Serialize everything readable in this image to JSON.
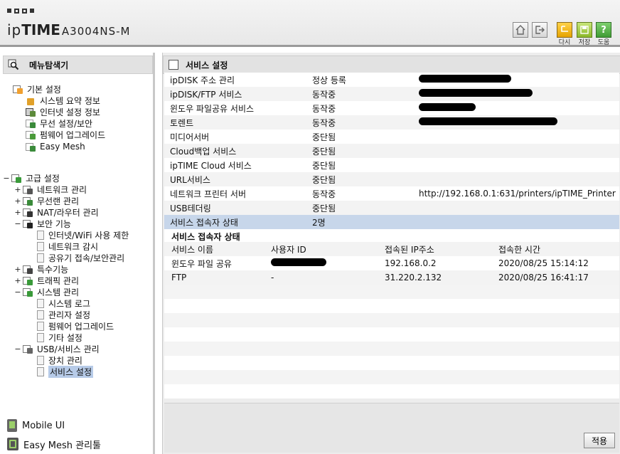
{
  "header": {
    "brand_light": "ip",
    "brand_bold": "TIME",
    "model": "A3004NS-M",
    "buttons": [
      {
        "icon": "home-icon",
        "label": ""
      },
      {
        "icon": "logout-icon",
        "label": ""
      },
      {
        "icon": "reload-icon",
        "label": "다시"
      },
      {
        "icon": "save-icon",
        "label": "저장"
      },
      {
        "icon": "help-icon",
        "label": "도움"
      }
    ]
  },
  "sidebar": {
    "title": "메뉴탐색기",
    "basic": {
      "label": "기본 설정",
      "items": [
        "시스템 요약 정보",
        "인터넷 설정 정보",
        "무선 설정/보안",
        "펌웨어 업그레이드",
        "Easy Mesh"
      ]
    },
    "advanced": {
      "label": "고급 설정",
      "groups": [
        {
          "toggle": "+",
          "label": "네트워크 관리"
        },
        {
          "toggle": "+",
          "label": "무선랜 관리"
        },
        {
          "toggle": "+",
          "label": "NAT/라우터 관리"
        },
        {
          "toggle": "−",
          "label": "보안 기능",
          "children": [
            "인터넷/WiFi 사용 제한",
            "네트워크 감시",
            "공유기 접속/보안관리"
          ]
        },
        {
          "toggle": "+",
          "label": "특수기능"
        },
        {
          "toggle": "+",
          "label": "트래픽 관리"
        },
        {
          "toggle": "−",
          "label": "시스템 관리",
          "children": [
            "시스템 로그",
            "관리자 설정",
            "펌웨어 업그레이드",
            "기타 설정"
          ]
        },
        {
          "toggle": "−",
          "label": "USB/서비스 관리",
          "children": [
            "장치 관리",
            "서비스 설정"
          ]
        }
      ]
    },
    "advanced_toggle": "−",
    "bottom_links": [
      "Mobile UI",
      "Easy Mesh 관리툴"
    ]
  },
  "main": {
    "title": "서비스 설정",
    "services": [
      {
        "name": "ipDISK 주소 관리",
        "status": "정상 등록",
        "info": "",
        "redact_width": 130
      },
      {
        "name": "ipDISK/FTP 서비스",
        "status": "동작중",
        "info": "",
        "redact_width": 160
      },
      {
        "name": "윈도우 파일공유 서비스",
        "status": "동작중",
        "info": "",
        "redact_width": 80
      },
      {
        "name": "토렌트",
        "status": "동작중",
        "info": "",
        "redact_width": 195
      },
      {
        "name": "미디어서버",
        "status": "중단됨",
        "info": ""
      },
      {
        "name": "Cloud백업 서비스",
        "status": "중단됨",
        "info": ""
      },
      {
        "name": "ipTIME Cloud 서비스",
        "status": "중단됨",
        "info": ""
      },
      {
        "name": "URL서비스",
        "status": "중단됨",
        "info": ""
      },
      {
        "name": "네트워크 프린터 서버",
        "status": "동작중",
        "info": "http://192.168.0.1:631/printers/ipTIME_Printer"
      },
      {
        "name": "USB테더링",
        "status": "중단됨",
        "info": ""
      },
      {
        "name": "서비스 접속자 상태",
        "status": "2명",
        "info": "",
        "highlight": true
      }
    ],
    "connections": {
      "title": "서비스 접속자 상태",
      "headers": [
        "서비스 이름",
        "사용자 ID",
        "접속된 IP주소",
        "접속한 시간"
      ],
      "rows": [
        {
          "service": "윈도우 파일 공유",
          "user": "",
          "ip": "192.168.0.2",
          "time": "2020/08/25 15:14:12",
          "redacted": true
        },
        {
          "service": "FTP",
          "user": "-",
          "ip": "31.220.2.132",
          "time": "2020/08/25 16:41:17",
          "redacted": false
        }
      ]
    },
    "apply_label": "적용"
  }
}
